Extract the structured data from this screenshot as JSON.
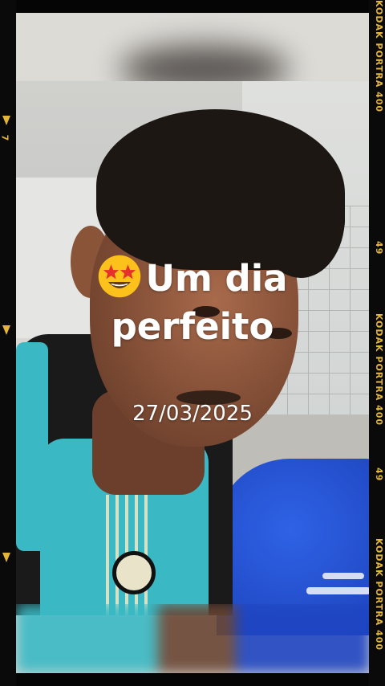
{
  "overlay": {
    "line1": "Um dia",
    "line2": "perfeito",
    "date": "27/03/2025",
    "emoji": "star-struck-emoji"
  },
  "film": {
    "brand_top": "KODAK PORTRA 400",
    "frame_a": "49",
    "brand_mid": "KODAK PORTRA 400",
    "frame_b": "49",
    "brand_bottom": "KODAK PORTRA 400",
    "left_number": "7"
  },
  "colors": {
    "film_text": "#e3b63a",
    "shirt_teal": "#3ab9c4",
    "chair_blue": "#2450d8"
  }
}
